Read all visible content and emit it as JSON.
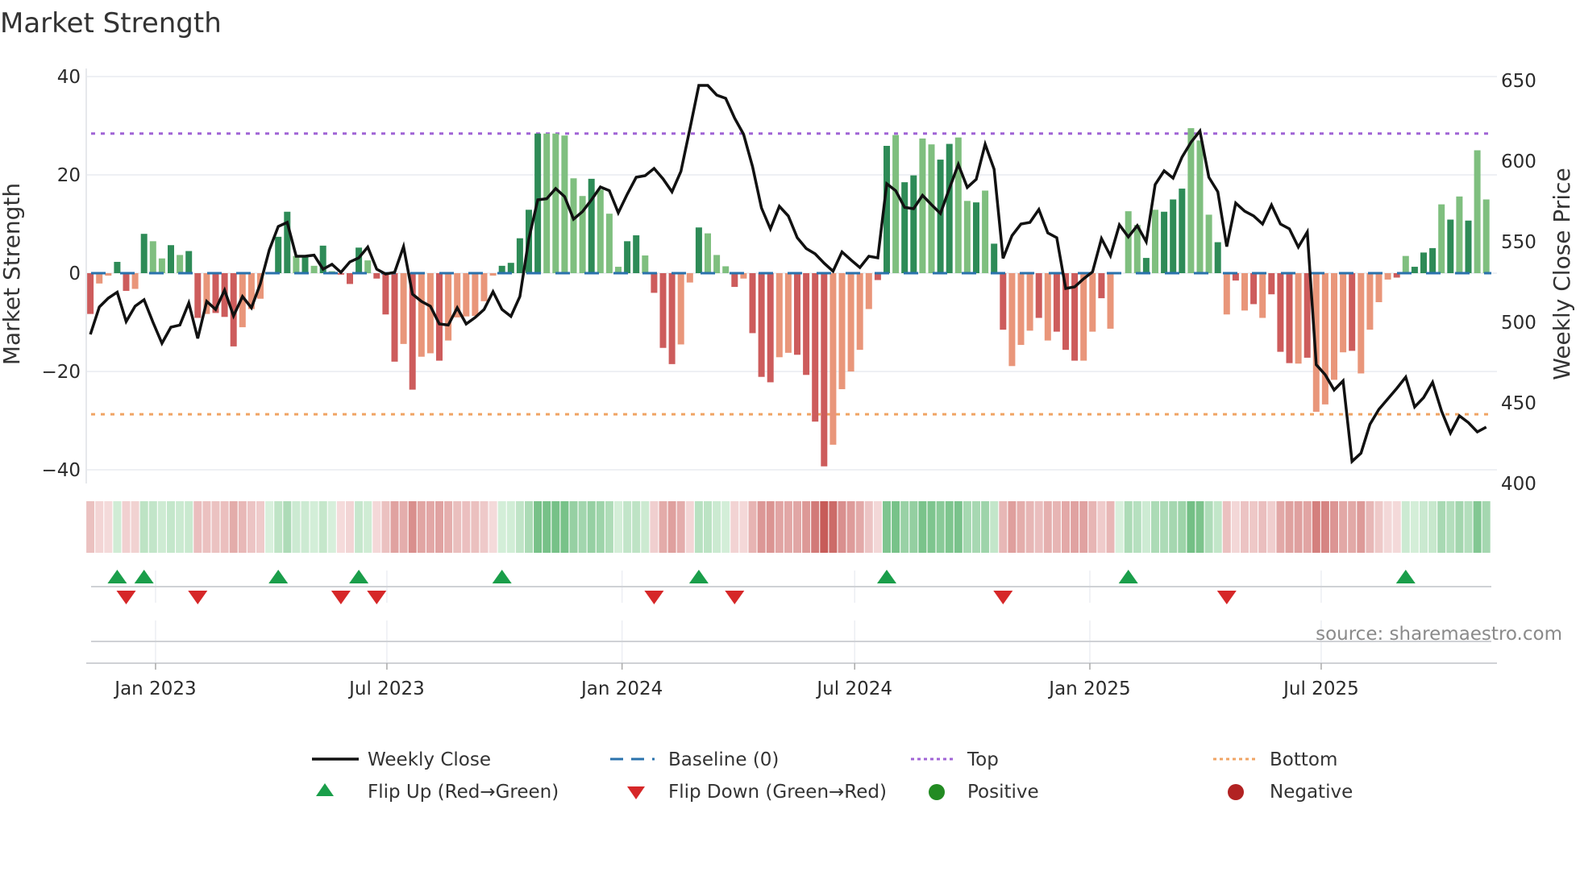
{
  "chart_data": {
    "type": "bar+line",
    "title": "Market Strength",
    "left_axis": {
      "label": "Market Strength",
      "ticks": [
        40,
        20,
        0,
        -20,
        -40
      ],
      "tick_labels": [
        "40",
        "20",
        "0",
        "−20",
        "−40"
      ],
      "range": [
        -42,
        42
      ]
    },
    "right_axis": {
      "label": "Weekly Close Price",
      "ticks": [
        650,
        600,
        550,
        500,
        450,
        400
      ],
      "tick_labels": [
        "650",
        "600",
        "550",
        "500",
        "450",
        "400"
      ],
      "range": [
        400,
        650
      ]
    },
    "x": {
      "start": "2022-11-11",
      "step_days": 7,
      "ticks": [
        {
          "date": "2023-01-01",
          "label": "Jan 2023"
        },
        {
          "date": "2023-07-01",
          "label": "Jul 2023"
        },
        {
          "date": "2024-01-01",
          "label": "Jan 2024"
        },
        {
          "date": "2024-07-01",
          "label": "Jul 2024"
        },
        {
          "date": "2025-01-01",
          "label": "Jan 2025"
        },
        {
          "date": "2025-07-01",
          "label": "Jul 2025"
        }
      ]
    },
    "top_level": 28.4,
    "bottom_level": -28.7,
    "baseline": 0,
    "strength": [
      -8.3,
      -2.1,
      -0.5,
      2.3,
      -3.6,
      -3.2,
      8.0,
      6.5,
      3.0,
      5.7,
      3.7,
      4.5,
      -9.1,
      -8.3,
      -8.1,
      -8.9,
      -14.9,
      -11,
      -7.3,
      -5.2,
      0,
      7.4,
      12.5,
      3.5,
      3.5,
      1.5,
      5.6,
      0.4,
      -0.3,
      -2.2,
      5.2,
      2.6,
      -1.1,
      -8.4,
      -18,
      -14.4,
      -23.7,
      -17,
      -16.3,
      -17.8,
      -13.7,
      -9,
      -8.8,
      -8.7,
      -5.7,
      -0.5,
      1.5,
      2.1,
      7.1,
      12.9,
      28.4,
      28.4,
      28.4,
      28,
      19.3,
      15.7,
      19.2,
      17,
      12.1,
      1.3,
      6.5,
      7.7,
      3.6,
      -4,
      -15.2,
      -18.5,
      -14.5,
      -1.9,
      9.3,
      8.1,
      3.7,
      1.4,
      -2.8,
      -1.1,
      -12.2,
      -21.1,
      -22.2,
      -17.1,
      -16.2,
      -16.6,
      -20.7,
      -30.2,
      -39.3,
      -34.9,
      -23.6,
      -20,
      -15.6,
      -7.3,
      -1.4,
      25.9,
      28.1,
      18.5,
      19.9,
      27.4,
      26.2,
      23.1,
      26.3,
      27.6,
      14.7,
      14.4,
      16.8,
      6,
      -11.5,
      -18.9,
      -14.6,
      -11.7,
      -9.1,
      -13.7,
      -11.9,
      -15.6,
      -17.8,
      -17.8,
      -11.9,
      -5.1,
      -11.3,
      0,
      12.6,
      9.8,
      3.1,
      12.9,
      12.5,
      15,
      17.2,
      29.5,
      27,
      11.9,
      6.3,
      -8.4,
      -1.5,
      -7.6,
      -6.3,
      -9.1,
      -4.3,
      -16,
      -18.3,
      -18.4,
      -17.2,
      -28.2,
      -26.7,
      -21.7,
      -16.1,
      -15.8,
      -20.4,
      -11.5,
      -5.9,
      -1.3,
      -0.9,
      3.5,
      1.3,
      4.2,
      5.1,
      14,
      10.9,
      15.6,
      10.7,
      25,
      15
    ],
    "shade": "dllddldlldlddldddllllddldldldddldddldlldlllllldddddllllldlllddldddlldllldldddllddddlllllddlddllddlldlddllldldddlldldlldldddllldldldldddldlllldlllldldddldldl",
    "price": [
      492.5,
      509.5,
      515,
      518.7,
      500.5,
      510,
      514,
      500,
      487,
      497,
      498.3,
      512,
      490,
      513,
      508,
      520,
      504,
      516,
      509,
      524,
      545,
      559.5,
      562,
      541,
      541,
      541.7,
      533,
      536,
      531,
      537.5,
      540,
      546.7,
      533,
      530,
      531,
      547,
      517.5,
      513,
      510,
      499,
      498.3,
      509,
      499,
      503,
      508,
      519,
      508,
      503.7,
      516,
      551.7,
      576,
      576.7,
      583,
      578,
      564,
      568.7,
      576,
      584,
      581.7,
      568,
      579.5,
      590,
      591,
      595.5,
      589,
      581,
      593.7,
      620,
      647,
      647,
      641,
      639,
      626.7,
      616.7,
      596.7,
      571,
      558,
      572,
      566,
      552.5,
      545.8,
      542.5,
      536.7,
      531.7,
      543.7,
      538.7,
      534,
      541,
      540,
      586,
      581.7,
      571.3,
      570.5,
      578.8,
      573,
      567.5,
      583,
      598,
      583.7,
      588.7,
      610.5,
      595,
      539.7,
      553.8,
      561,
      562,
      570,
      555.5,
      552.5,
      521,
      522,
      527,
      531.3,
      552,
      541.3,
      560.5,
      553,
      560,
      550,
      585.5,
      594,
      589.5,
      602.5,
      611.7,
      618.7,
      590,
      581,
      547,
      574,
      569,
      566,
      561,
      572.8,
      561,
      558,
      546.7,
      556,
      473.7,
      467.5,
      458,
      463.7,
      413.7,
      418.8,
      436.7,
      446,
      452.5,
      459,
      466,
      447.5,
      453.3,
      462.8,
      445,
      431.3,
      442,
      437.8,
      432,
      435
    ],
    "flips_up": [
      3,
      6,
      21,
      30,
      46,
      68,
      89,
      116,
      147
    ],
    "flips_down": [
      4,
      12,
      28,
      32,
      63,
      72,
      102,
      127
    ],
    "legend": {
      "weekly_close": "Weekly Close",
      "baseline": "Baseline (0)",
      "top": "Top",
      "bottom": "Bottom",
      "flip_up": "Flip Up (Red→Green)",
      "flip_down": "Flip Down (Green→Red)",
      "positive": "Positive",
      "negative": "Negative"
    },
    "source": "source: sharemaestro.com",
    "colors": {
      "pos_dark": "#2e8b57",
      "pos_light": "#7fbf7f",
      "neg_dark": "#cd5c5c",
      "neg_light": "#e9967a",
      "top": "#a064d6",
      "bottom": "#f0a464",
      "baseline": "#2a72ac",
      "line": "#111111",
      "flip_up": "#1a9e4a",
      "flip_down": "#d62728",
      "positive": "#228b22",
      "negative": "#b22222"
    }
  }
}
